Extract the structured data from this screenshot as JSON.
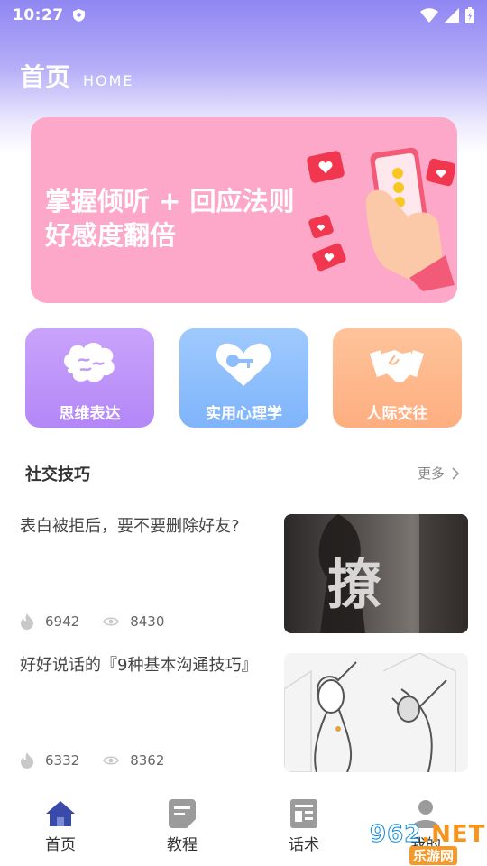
{
  "status_bar": {
    "time": "10:27"
  },
  "header": {
    "title": "首页",
    "subtitle": "HOME"
  },
  "banner": {
    "line1": "掌握倾听 + 回应法则",
    "line2": "好感度翻倍"
  },
  "categories": [
    {
      "label": "思维表达",
      "icon": "brain-icon",
      "color": "#b98cf8"
    },
    {
      "label": "实用心理学",
      "icon": "heart-key-icon",
      "color": "#8cbdfc"
    },
    {
      "label": "人际交往",
      "icon": "handshake-icon",
      "color": "#feb68a"
    }
  ],
  "section": {
    "title": "社交技巧",
    "more": "更多"
  },
  "articles": [
    {
      "title": "表白被拒后，要不要删除好友?",
      "likes": "6942",
      "views": "8430",
      "thumb_text": "撩"
    },
    {
      "title": "好好说话的『9种基本沟通技巧』",
      "likes": "6332",
      "views": "8362"
    }
  ],
  "nav": [
    {
      "label": "首页",
      "icon": "home-icon",
      "active": true
    },
    {
      "label": "教程",
      "icon": "document-icon"
    },
    {
      "label": "话术",
      "icon": "layout-icon"
    },
    {
      "label": "我的",
      "icon": "user-icon"
    }
  ],
  "watermark": {
    "top_digits": "962",
    "top_suffix": ".NET",
    "bottom": "乐游网"
  }
}
